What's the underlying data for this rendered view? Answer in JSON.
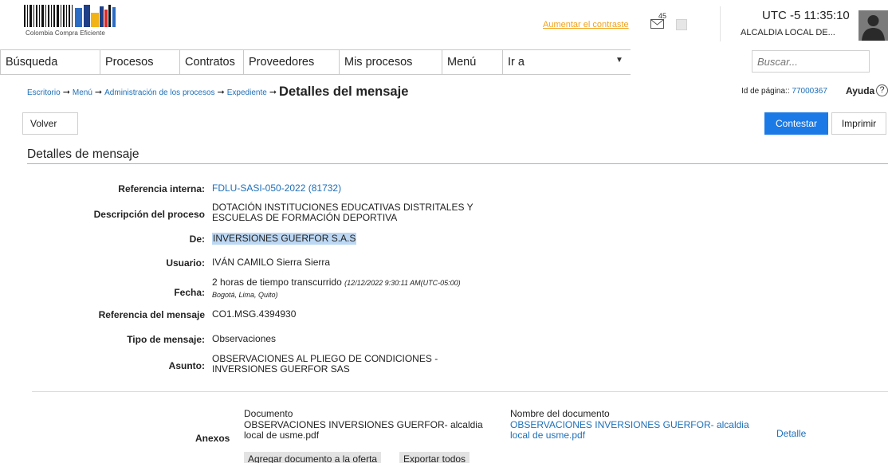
{
  "header": {
    "logo_text": "Colombia Compra Eficiente",
    "contrast_link": "Aumentar el contraste",
    "mail_count": "45",
    "utc_time": "UTC -5 11:35:10",
    "entity": "ALCALDIA LOCAL DE..."
  },
  "nav": {
    "items": [
      "Búsqueda",
      "Procesos",
      "Contratos",
      "Proveedores",
      "Mis procesos",
      "Menú",
      "Ir a"
    ],
    "search_placeholder": "Buscar..."
  },
  "breadcrumb": {
    "items": [
      "Escritorio",
      "Menú",
      "Administración de los procesos",
      "Expediente"
    ],
    "current": "Detalles del mensaje"
  },
  "page_info": {
    "id_label": "Id de página::",
    "id_value": "77000367",
    "help": "Ayuda"
  },
  "buttons": {
    "back": "Volver",
    "reply": "Contestar",
    "print": "Imprimir"
  },
  "section": {
    "title": "Detalles de mensaje"
  },
  "details": {
    "ref_interna_label": "Referencia interna:",
    "ref_interna_value": "FDLU-SASI-050-2022 (81732)",
    "descripcion_label": "Descripción del proceso",
    "descripcion_line1": "DOTACIÓN INSTITUCIONES EDUCATIVAS DISTRITALES Y",
    "descripcion_line2": "ESCUELAS DE FORMACIÓN DEPORTIVA",
    "de_label": "De:",
    "de_value": "INVERSIONES GUERFOR S.A.S",
    "usuario_label": "Usuario:",
    "usuario_value": "IVÁN CAMILO Sierra Sierra",
    "fecha_label": "Fecha:",
    "fecha_value": "2 horas de tiempo transcurrido",
    "fecha_detail": "(12/12/2022 9:30:11 AM(UTC-05:00)",
    "fecha_zone": "Bogotá, Lima, Quito)",
    "ref_mensaje_label": "Referencia del mensaje",
    "ref_mensaje_value": "CO1.MSG.4394930",
    "tipo_label": "Tipo de mensaje:",
    "tipo_value": "Observaciones",
    "asunto_label": "Asunto:",
    "asunto_line1": "OBSERVACIONES AL PLIEGO DE CONDICIONES -",
    "asunto_line2": "INVERSIONES GUERFOR SAS"
  },
  "attachments": {
    "label": "Anexos",
    "col_document": "Documento",
    "col_name": "Nombre del documento",
    "doc_line1": "OBSERVACIONES INVERSIONES GUERFOR- alcaldia",
    "doc_line2": "local de usme.pdf",
    "name_line1": "OBSERVACIONES INVERSIONES GUERFOR- alcaldia",
    "name_line2": "local de usme.pdf",
    "detail_link": "Detalle",
    "add_button": "Agregar documento a la oferta",
    "export_button": "Exportar todos"
  },
  "colors": {
    "accent": "#1b7ae6",
    "link": "#1d6fb8",
    "contrast_link": "#f0a21c",
    "highlight": "#bcd7f3"
  }
}
